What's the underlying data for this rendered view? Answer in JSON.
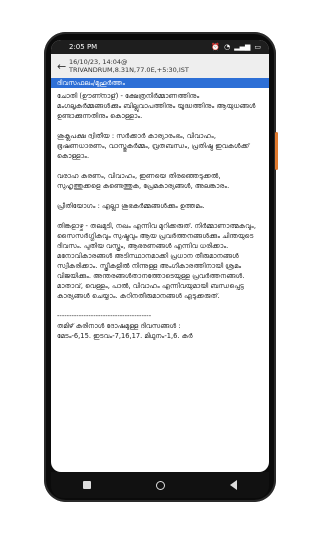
{
  "status": {
    "time": "2:05 PM",
    "icons": [
      "alarm-icon",
      "vibrate-icon",
      "wifi-icon",
      "signal-icon",
      "battery-icon"
    ]
  },
  "header": {
    "back_icon": "arrow-left",
    "date_line": "16/10/23, 14:04@",
    "location_line": "TRIVANDRUM,8.31N,77.0E,+5:30,IST"
  },
  "section": {
    "title": "ദിവസഫലം/മുഹൂർത്തം"
  },
  "paragraphs": [
    "ചോതി (ഊണ്നാള്) - ക്ഷേത്രനിർമ്മാണത്തിനും മംഗലൃകർമ്മങ്ങൾക്കും ബില്ലുവാപത്തിനും യൂദ്ധത്തിനും ആയുധങ്ങൾ ഉണ്ടാക്കുന്നതിനും കൊള്ളാം.",
    "ശുക്ലപക്ഷ ദ്വിതീയ : സർക്കാർ കാര്യാരംഭം, വിവാഹം, ഭൂഷണധാരണം, വാസ്തുകർമ്മം, വ്രതബന്ധം, പ്രതിഷ്ഠ ഇവകൾക്ക് കൊള്ളാം.",
    "വരാഹ കരണം, വിവാഹം, ഇണയെ തിരഞ്ഞെടുക്കൽ, സുഹൃത്തുക്കളെ കണ്ടെത്തുക, പ്രേമകാര്യങ്ങൾ, അലങ്കാരം.",
    "പ്രീതിയോഗം : എല്ലാ ശുഭകർമ്മങ്ങൾക്കും ഉത്തമം.",
    "തിങ്കളാഴ്ച - തലമുടി, നഖം എന്നിവ മുറിക്കരുത്. നിർമ്മാണാത്മകവും, സൈസർഗ്ഗികവും സുഷ്മവും ആയ പ്രവർത്തനങ്ങൾക്കും ചിന്തയുടെ ദിവസം. പുതിയ വസ്ത്രം, ആഭരണങ്ങൾ എന്നിവ ധരിക്കാം. മനോവികാരങ്ങൾ അടിസ്ഥാനമാക്കി പ്രധാന തീരുമാനങ്ങൾ സ്വീകരിക്കാം. സ്ത്രീകളിൽ നിന്നുള്ള അംഗീകാരത്തിനായി ശ്രമം വിജയിക്കും. അന്തരങ്ങൾതാനത്തോടെയുള്ള പ്രവർത്തനങ്ങൾ. മാതാവ്, വെള്ളം, പാൽ, വിവാഹം എന്നിവയുമായി ബന്ധപ്പെട്ട കാര്യങ്ങൾ ചെയ്യാം. കഠിനതീരുമാനങ്ങൾ എടുക്കരുത്."
  ],
  "divider": "---------------------------------------",
  "footer_lines": [
    "തമിഴ് കരിനാൾ ദോഷമുള്ള ദിവസങ്ങൾ :",
    "മേടം-6,15. ഇടവം-7,16,17. മിഥുനം-1,6. കർ"
  ]
}
